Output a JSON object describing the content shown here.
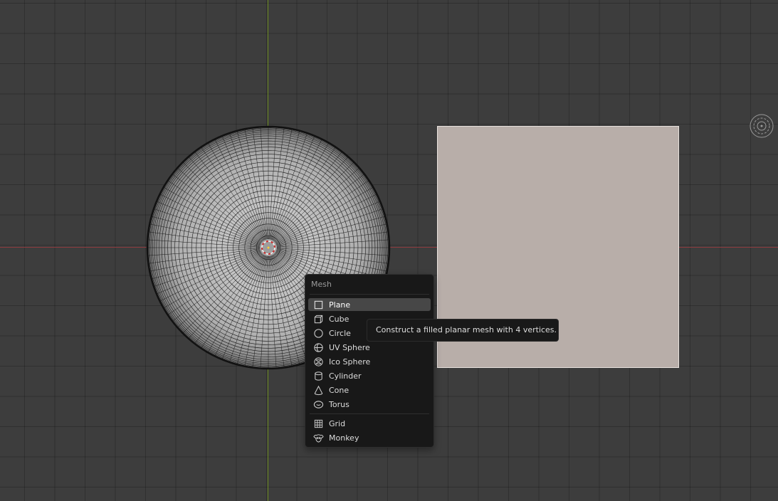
{
  "scene": {
    "objects": [
      "uv-sphere",
      "plane"
    ],
    "colors": {
      "background": "#3d3d3d",
      "x_axis": "#8d3b3f",
      "y_axis": "#6a8a1e",
      "plane_surface": "#b8aea9"
    }
  },
  "menu": {
    "title": "Mesh",
    "items": [
      {
        "label": "Plane",
        "icon": "plane-icon"
      },
      {
        "label": "Cube",
        "icon": "cube-icon"
      },
      {
        "label": "Circle",
        "icon": "circle-icon"
      },
      {
        "label": "UV Sphere",
        "icon": "uv-sphere-icon"
      },
      {
        "label": "Ico Sphere",
        "icon": "ico-sphere-icon"
      },
      {
        "label": "Cylinder",
        "icon": "cylinder-icon"
      },
      {
        "label": "Cone",
        "icon": "cone-icon"
      },
      {
        "label": "Torus",
        "icon": "torus-icon"
      },
      {
        "label": "Grid",
        "icon": "grid-icon"
      },
      {
        "label": "Monkey",
        "icon": "monkey-icon"
      }
    ],
    "highlighted": "Plane"
  },
  "tooltip": {
    "text": "Construct a filled planar mesh with 4 vertices."
  }
}
